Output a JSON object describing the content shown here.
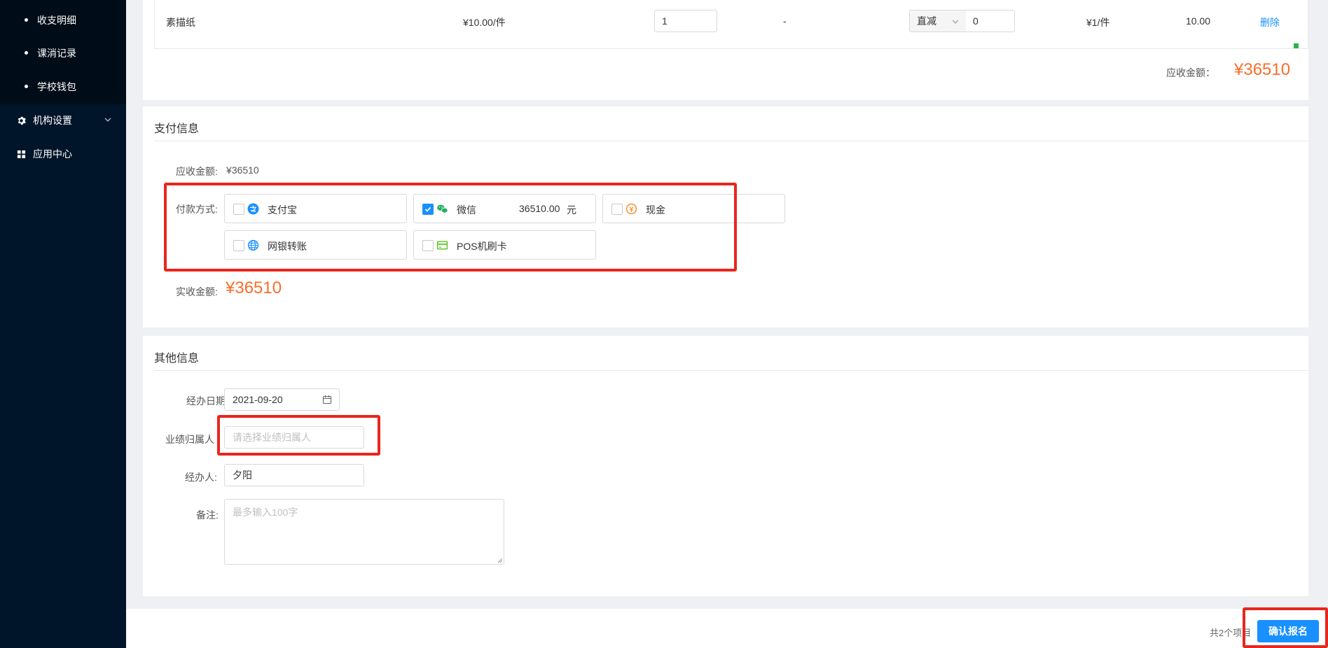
{
  "sidebar": {
    "sub_items": [
      {
        "label": "收支明细"
      },
      {
        "label": "课消记录"
      },
      {
        "label": "学校钱包"
      }
    ],
    "menu_items": [
      {
        "label": "机构设置",
        "icon": "gear-icon"
      },
      {
        "label": "应用中心",
        "icon": "grid-icon"
      }
    ]
  },
  "product_row": {
    "name": "素描纸",
    "price": "¥10.00/件",
    "quantity": "1",
    "dash": "-",
    "discount_type": "直减",
    "discount_value": "0",
    "unit_price": "¥1/件",
    "subtotal": "10.00",
    "delete_label": "删除"
  },
  "receivable": {
    "label": "应收金额：",
    "value": "¥36510"
  },
  "payment": {
    "title": "支付信息",
    "receivable_label": "应收金额:",
    "receivable_value": "¥36510",
    "method_label": "付款方式:",
    "methods": [
      {
        "name": "支付宝",
        "icon": "alipay-icon",
        "checked": false,
        "amount": "",
        "unit": ""
      },
      {
        "name": "微信",
        "icon": "wechat-icon",
        "checked": true,
        "amount": "36510.00",
        "unit": "元"
      },
      {
        "name": "现金",
        "icon": "cash-icon",
        "checked": false,
        "amount": "",
        "unit": ""
      },
      {
        "name": "网银转账",
        "icon": "globe-icon",
        "checked": false,
        "amount": "",
        "unit": ""
      },
      {
        "name": "POS机刷卡",
        "icon": "card-icon",
        "checked": false,
        "amount": "",
        "unit": ""
      }
    ],
    "actual_label": "实收金额:",
    "actual_value": "¥36510"
  },
  "other": {
    "title": "其他信息",
    "date_label": "经办日期:",
    "date_value": "2021-09-20",
    "owner_label": "业绩归属人",
    "owner_placeholder": "请选择业绩归属人",
    "handler_label": "经办人:",
    "handler_value": "夕阳",
    "note_label": "备注:",
    "note_placeholder": "最多输入100字"
  },
  "footer": {
    "count_text": "共2个项目",
    "confirm_label": "确认报名"
  },
  "colors": {
    "sidebar_bg": "#001529",
    "accent": "#1890ff",
    "amount_orange": "#f96e2a",
    "highlight_red": "#e8261d"
  }
}
